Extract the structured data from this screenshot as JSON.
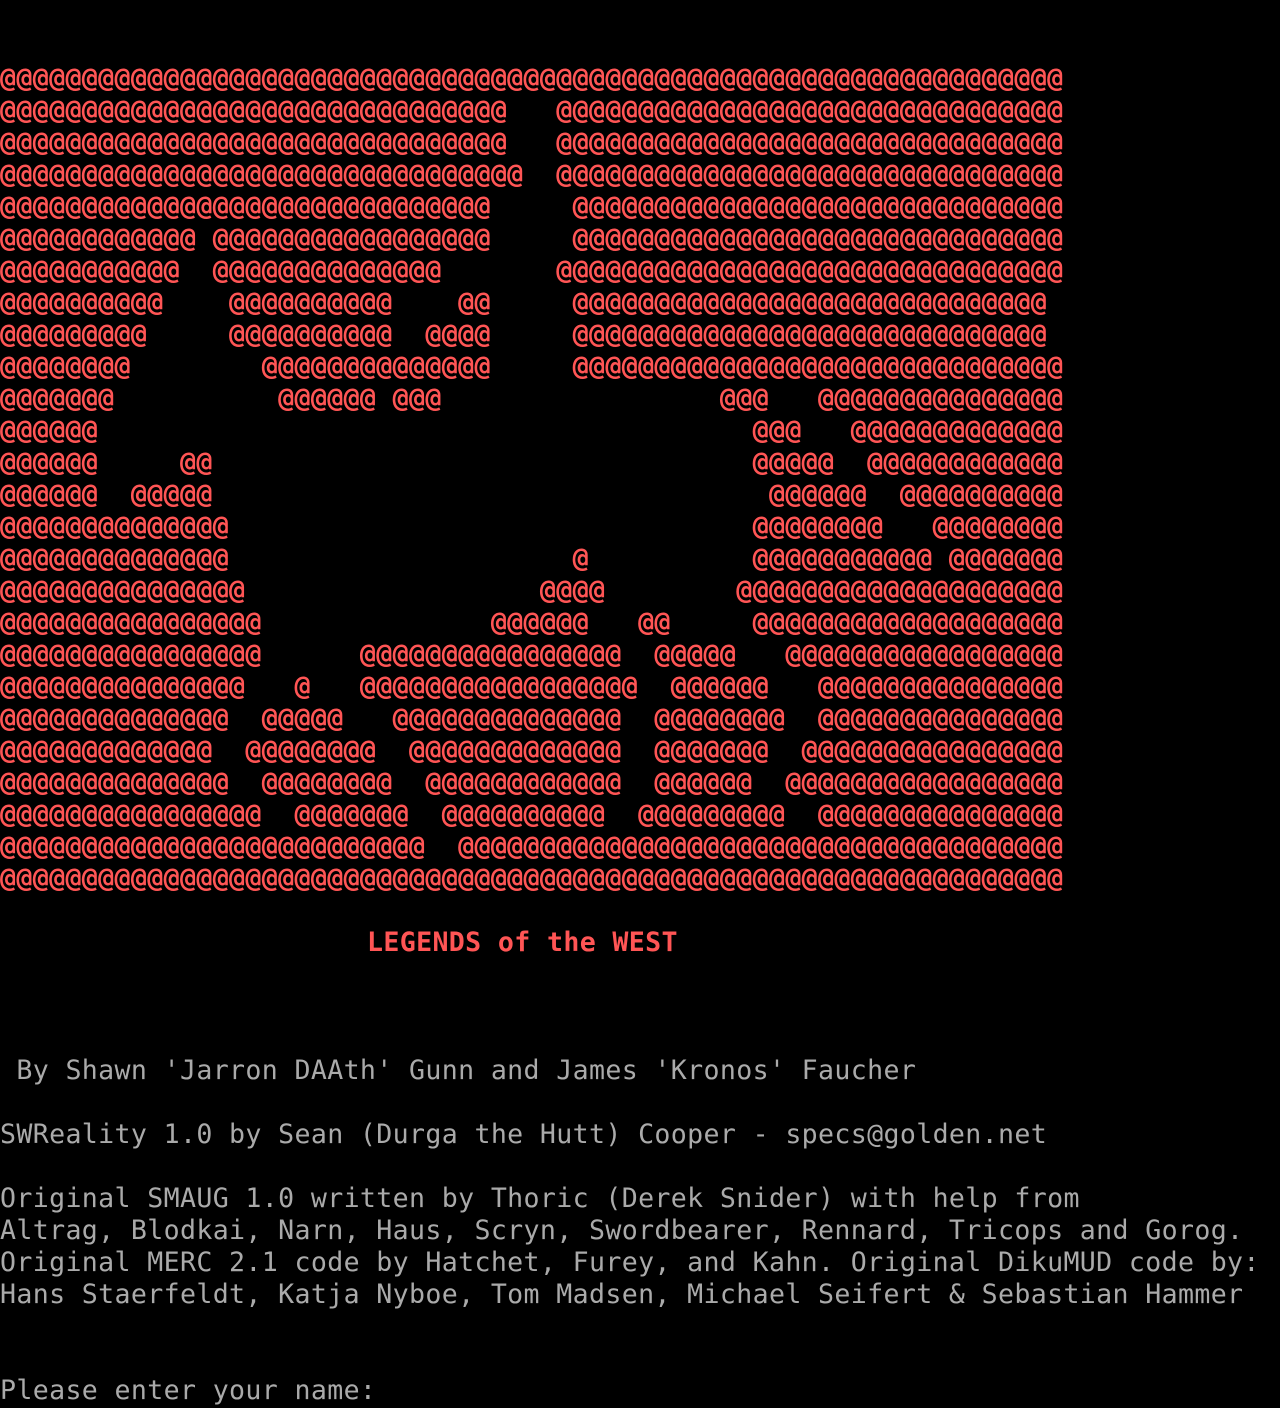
{
  "colors": {
    "background": "#000000",
    "art": "#ff5555",
    "text": "#aaaaaa"
  },
  "art_lines": [
    "@@@@@@@@@@@@@@@@@@@@@@@@@@@@@@@@@@@@@@@@@@@@@@@@@@@@@@@@@@@@@@@@@",
    "@@@@@@@@@@@@@@@@@@@@@@@@@@@@@@@   @@@@@@@@@@@@@@@@@@@@@@@@@@@@@@@",
    "@@@@@@@@@@@@@@@@@@@@@@@@@@@@@@@   @@@@@@@@@@@@@@@@@@@@@@@@@@@@@@@",
    "@@@@@@@@@@@@@@@@@@@@@@@@@@@@@@@@  @@@@@@@@@@@@@@@@@@@@@@@@@@@@@@@",
    "@@@@@@@@@@@@@@@@@@@@@@@@@@@@@@     @@@@@@@@@@@@@@@@@@@@@@@@@@@@@@",
    "@@@@@@@@@@@@ @@@@@@@@@@@@@@@@@     @@@@@@@@@@@@@@@@@@@@@@@@@@@@@@",
    "@@@@@@@@@@@  @@@@@@@@@@@@@@       @@@@@@@@@@@@@@@@@@@@@@@@@@@@@@@",
    "@@@@@@@@@@    @@@@@@@@@@    @@     @@@@@@@@@@@@@@@@@@@@@@@@@@@@@",
    "@@@@@@@@@     @@@@@@@@@@  @@@@     @@@@@@@@@@@@@@@@@@@@@@@@@@@@@",
    "@@@@@@@@        @@@@@@@@@@@@@@     @@@@@@@@@@@@@@@@@@@@@@@@@@@@@@",
    "@@@@@@@          @@@@@@ @@@                 @@@   @@@@@@@@@@@@@@@",
    "@@@@@@                                        @@@   @@@@@@@@@@@@@",
    "@@@@@@     @@                                 @@@@@  @@@@@@@@@@@@",
    "@@@@@@  @@@@@                                  @@@@@@  @@@@@@@@@@",
    "@@@@@@@@@@@@@@                                @@@@@@@@   @@@@@@@@",
    "@@@@@@@@@@@@@@                     @          @@@@@@@@@@@ @@@@@@@",
    "@@@@@@@@@@@@@@@                  @@@@        @@@@@@@@@@@@@@@@@@@@",
    "@@@@@@@@@@@@@@@@              @@@@@@   @@     @@@@@@@@@@@@@@@@@@@",
    "@@@@@@@@@@@@@@@@      @@@@@@@@@@@@@@@@  @@@@@   @@@@@@@@@@@@@@@@@",
    "@@@@@@@@@@@@@@@   @   @@@@@@@@@@@@@@@@@  @@@@@@   @@@@@@@@@@@@@@@",
    "@@@@@@@@@@@@@@  @@@@@   @@@@@@@@@@@@@@  @@@@@@@@  @@@@@@@@@@@@@@@",
    "@@@@@@@@@@@@@  @@@@@@@@  @@@@@@@@@@@@@  @@@@@@@  @@@@@@@@@@@@@@@@",
    "@@@@@@@@@@@@@@  @@@@@@@@  @@@@@@@@@@@@  @@@@@@  @@@@@@@@@@@@@@@@@",
    "@@@@@@@@@@@@@@@@  @@@@@@@  @@@@@@@@@@  @@@@@@@@@  @@@@@@@@@@@@@@@",
    "@@@@@@@@@@@@@@@@@@@@@@@@@@  @@@@@@@@@@@@@@@@@@@@@@@@@@@@@@@@@@@@@",
    "@@@@@@@@@@@@@@@@@@@@@@@@@@@@@@@@@@@@@@@@@@@@@@@@@@@@@@@@@@@@@@@@@"
  ],
  "title": "LEGENDS of the WEST",
  "credits": {
    "authors": " By Shawn 'Jarron DAAth' Gunn and James 'Kronos' Faucher",
    "swreality": "SWReality 1.0 by Sean (Durga the Hutt) Cooper - specs@golden.net",
    "smaug_1": "Original SMAUG 1.0 written by Thoric (Derek Snider) with help from",
    "smaug_2": "Altrag, Blodkai, Narn, Haus, Scryn, Swordbearer, Rennard, Tricops and Gorog.",
    "smaug_3": "Original MERC 2.1 code by Hatchet, Furey, and Kahn. Original DikuMUD code by:",
    "smaug_4": "Hans Staerfeldt, Katja Nyboe, Tom Madsen, Michael Seifert & Sebastian Hammer"
  },
  "login": {
    "prompt": "Please enter your name:",
    "value": ""
  }
}
